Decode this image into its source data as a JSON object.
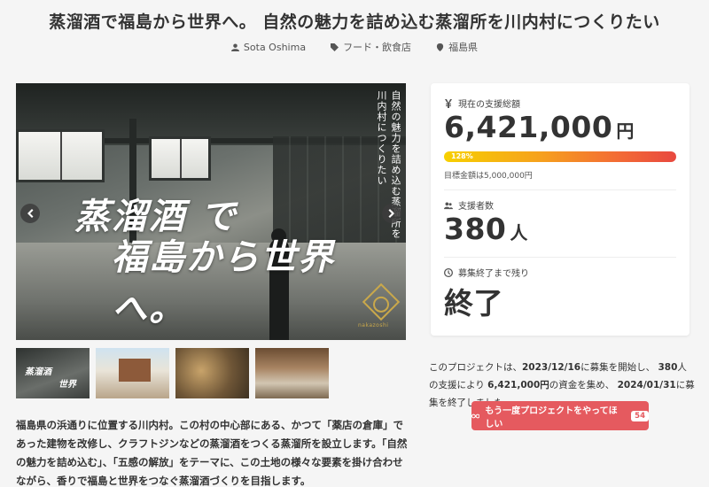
{
  "page_title": "蒸溜酒で福島から世界へ。 自然の魅力を詰め込む蒸溜所を川内村につくりたい",
  "meta": {
    "author": "Sota Oshima",
    "category": "フード・飲食店",
    "location": "福島県"
  },
  "hero": {
    "headline_line1": "蒸溜酒 で",
    "headline_line2": "福島から世界へ。",
    "vertical_text_1": "自然の魅力を詰め込む蒸溜所を",
    "vertical_text_2": "川内村につくりたい",
    "logo_text": "nakazoshi"
  },
  "thumbnails": [
    {
      "text_a": "蒸溜酒",
      "text_b": "世界"
    },
    {},
    {},
    {}
  ],
  "description": "福島県の浜通りに位置する川内村。この村の中心部にある、かつて「薬店の倉庫」であった建物を改修し、クラフトジンなどの蒸溜酒をつくる蒸溜所を設立します。「自然の魅力を詰め込む」、「五感の解放」をテーマに、この土地の様々な要素を掛け合わせながら、香りで福島と世界をつなぐ蒸溜酒づくりを目指します。",
  "stats": {
    "funding_label": "現在の支援総額",
    "funding_amount": "6,421,000",
    "funding_unit": "円",
    "progress_percent": 128,
    "progress_label": "128%",
    "goal_text": "目標金額は5,000,000円",
    "supporters_label": "支援者数",
    "supporters_count": "380",
    "supporters_unit": "人",
    "remaining_label": "募集終了まで残り",
    "remaining_value": "終了"
  },
  "summary": {
    "part1": "このプロジェクトは、",
    "start_date": "2023/12/16",
    "part2": "に募集を開始し、",
    "count": "380",
    "part3": "人の支援により",
    "amount": "6,421,000円",
    "part4": "の資金を集め、",
    "end_date": "2024/01/31",
    "part5": "に募集を終了しました"
  },
  "cta": {
    "label": "もう一度プロジェクトをやってほしい",
    "count": "54"
  },
  "colors": {
    "accent": "#e55a5f",
    "progress_start": "#f7d000",
    "progress_end": "#e8483f"
  }
}
